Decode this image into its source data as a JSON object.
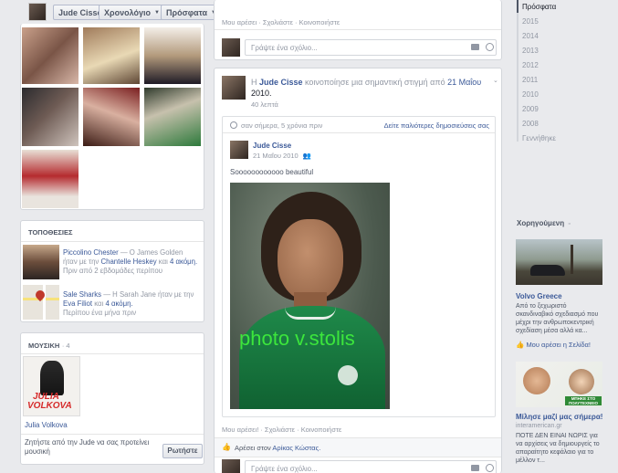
{
  "top_bar": {
    "profile_name": "Jude Cisse",
    "timeline_label": "Χρονολόγιο",
    "recent_label": "Πρόσφατα"
  },
  "timeline_nav": {
    "years": [
      "Πρόσφατα",
      "2015",
      "2014",
      "2013",
      "2012",
      "2011",
      "2010",
      "2009",
      "2008",
      "Γεννήθηκε"
    ]
  },
  "top_post_actions": "Μου αρέσει · Σχολιάστε · Κοινοποιήστε",
  "comment_placeholder": "Γράψτε ένα σχόλιο...",
  "places": {
    "title": "ΤΟΠΟΘΕΣΙΕΣ",
    "items": [
      {
        "name": "Piccolino Chester",
        "line1_rest": " — Ο James Golden",
        "line2_prefix": "ήταν με την ",
        "line2_link": "Chantelle Heskey",
        "line2_mid": " και ",
        "line2_more": "4 ακόμη.",
        "time": "Πριν από 2 εβδομάδες περίπου"
      },
      {
        "name": "Sale Sharks",
        "line1_rest": " — Η Sarah Jane ήταν με την",
        "line2_prefix": "",
        "line2_link": "Eva Filiot",
        "line2_mid": " και ",
        "line2_more": "4 ακόμη.",
        "time": "Περίπου ένα μήνα πριν"
      }
    ]
  },
  "music": {
    "title": "ΜΟΥΣΙΚΗ",
    "count": "· 4",
    "artist": "Julia Volkova",
    "cover_text_1": "JULIA",
    "cover_text_2": "VOLKOVA",
    "ask_text": "Ζητήστε από την Jude να σας προτείνει μουσική",
    "ask_button": "Ρωτήστε"
  },
  "post": {
    "author": "Jude Cisse",
    "prefix": "Η ",
    "action": " κοινοποίησε μια σημαντική στιγμή από ",
    "date_link": "21 Μαΐου",
    "year": "2010.",
    "time": "40 λεπτά",
    "memory_header": "σαν σήμερα, 5 χρόνια πριν",
    "memory_link": "Δείτε παλιότερες δημοσιεύσεις σας",
    "inner_author": "Jude Cisse",
    "inner_date": "21 Μαΐου 2010",
    "inner_text": "Soooooooooooo beautiful",
    "photo_watermark": "photo v.stolis",
    "actions": "Μου αρέσει! · Σχολιάστε · Κοινοποιήστε",
    "likes_prefix": "Αρέσει στον ",
    "likes_name": "Αρίκας Κώστας."
  },
  "sponsored": {
    "title": "Χορηγούμενη",
    "ad1": {
      "name": "Volvo Greece",
      "text": "Από το ξεχωριστό σκανδιναβικό σχεδιασμό που μέχρι την ανθρωποκεντρική σχεδίαση μέσα αλλά κα...",
      "like": "Μου αρέσει η Σελίδα!"
    },
    "ad2": {
      "banner": "ΜΠΗΚΕ ΣΤΟ ΠΟΛΥΤΕΧΝΕΙΟ",
      "name": "Μίλησε μαζί μας σήμερα!",
      "url": "interamerican.gr",
      "text": "ΠΟΤΕ ΔΕΝ ΕΙΝΑΙ ΝΩΡΙΣ για να αρχίσεις να δημιουργείς το απαραίτητο κεφάλαιο για το μέλλον τ..."
    }
  },
  "colors": {
    "link": "#3b5998",
    "border": "#d3d6db",
    "background": "#e9eaed",
    "watermark": "#3ce63c"
  }
}
